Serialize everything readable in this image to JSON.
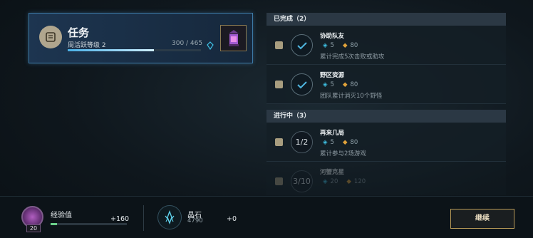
{
  "mission": {
    "title": "任务",
    "subtitle": "周活跃等级 2",
    "progress_text": "300 / 465",
    "progress_fraction": 0.645
  },
  "completed": {
    "header": "已完成（2）",
    "items": [
      {
        "name": "协助队友",
        "blue_reward": "5",
        "orange_reward": "80",
        "desc": "累计完成5次击败或助攻",
        "status": "✓"
      },
      {
        "name": "野区资源",
        "blue_reward": "5",
        "orange_reward": "80",
        "desc": "团队累计消灭10个野怪",
        "status": "✓"
      }
    ]
  },
  "in_progress": {
    "header": "进行中（3）",
    "items": [
      {
        "name": "再来几局",
        "blue_reward": "5",
        "orange_reward": "80",
        "desc": "累计参与2场游戏",
        "status": "1/2"
      },
      {
        "name": "河蟹克星",
        "blue_reward": "20",
        "orange_reward": "120",
        "desc": "",
        "status": "3/10"
      }
    ]
  },
  "bottom": {
    "xp_label": "经验值",
    "xp_gain": "+160",
    "level": "20",
    "xp_fraction": 0.08,
    "gem_label": "晶石",
    "gem_count": "4790",
    "gem_gain": "+0",
    "continue_label": "继续"
  },
  "colors": {
    "accent_blue": "#4ab0e6",
    "gold_border": "#b89a57",
    "reward_blue": "#3fc3e6",
    "reward_orange": "#e0a23a"
  }
}
